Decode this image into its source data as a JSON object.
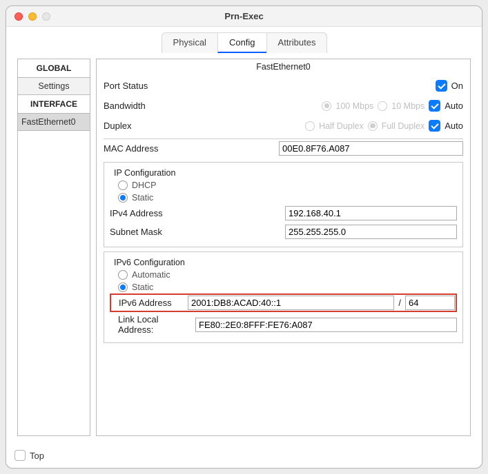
{
  "window": {
    "title": "Prn-Exec"
  },
  "tabs": {
    "physical": "Physical",
    "config": "Config",
    "attributes": "Attributes",
    "active": "config"
  },
  "sidebar": {
    "global_header": "GLOBAL",
    "settings": "Settings",
    "interface_header": "INTERFACE",
    "fe0": "FastEthernet0"
  },
  "panel": {
    "title": "FastEthernet0",
    "port_status_label": "Port Status",
    "on_label": "On",
    "bandwidth_label": "Bandwidth",
    "bw_100": "100 Mbps",
    "bw_10": "10 Mbps",
    "auto_label": "Auto",
    "duplex_label": "Duplex",
    "dup_half": "Half Duplex",
    "dup_full": "Full Duplex",
    "mac_label": "MAC Address",
    "mac_value": "00E0.8F76.A087",
    "ip_config_title": "IP Configuration",
    "dhcp": "DHCP",
    "static": "Static",
    "ipv4_label": "IPv4 Address",
    "ipv4_value": "192.168.40.1",
    "subnet_label": "Subnet Mask",
    "subnet_value": "255.255.255.0",
    "ipv6_config_title": "IPv6 Configuration",
    "automatic": "Automatic",
    "ipv6_label": "IPv6 Address",
    "ipv6_value": "2001:DB8:ACAD:40::1",
    "slash": "/",
    "prefix_value": "64",
    "ll_label": "Link Local Address:",
    "ll_value": "FE80::2E0:8FFF:FE76:A087"
  },
  "footer": {
    "top": "Top"
  }
}
